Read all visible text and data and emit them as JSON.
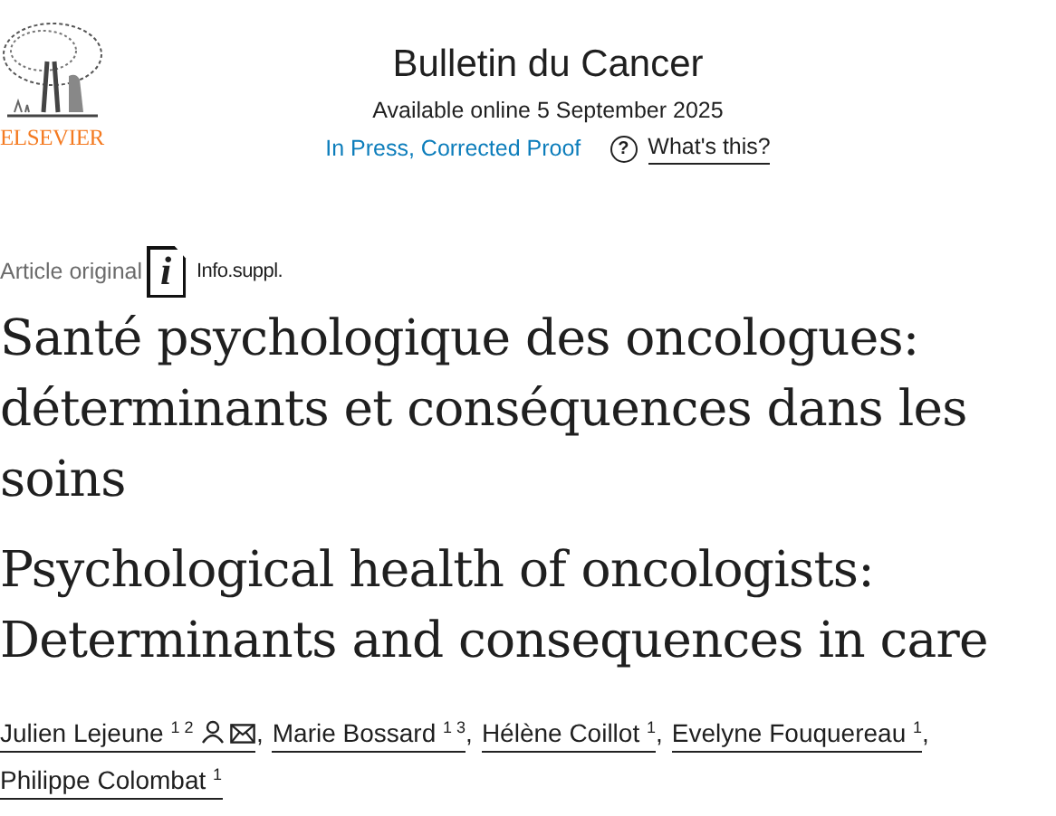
{
  "publisher": {
    "name": "ELSEVIER"
  },
  "journal": {
    "title": "Bulletin du Cancer",
    "date": "Available online 5 September 2025",
    "status": "In Press, Corrected Proof",
    "help_icon": "?",
    "help_link": "What's this?"
  },
  "article_type": "Article original",
  "supplement": {
    "icon": "i",
    "label": "Info.suppl."
  },
  "title_fr": "Santé psychologique des oncologues: déterminants et conséquences dans les soins",
  "title_en": "Psychological health of oncologists: Determinants and consequences in care",
  "authors": [
    {
      "name": "Julien Lejeune",
      "sup": "1 2",
      "corresponding": true,
      "separator": ","
    },
    {
      "name": "Marie Bossard",
      "sup": "1 3",
      "corresponding": false,
      "separator": ","
    },
    {
      "name": "Hélène Coillot",
      "sup": "1",
      "corresponding": false,
      "separator": ","
    },
    {
      "name": "Evelyne Fouquereau",
      "sup": "1",
      "corresponding": false,
      "separator": ","
    },
    {
      "name": "Philippe Colombat",
      "sup": "1",
      "corresponding": false
    }
  ]
}
